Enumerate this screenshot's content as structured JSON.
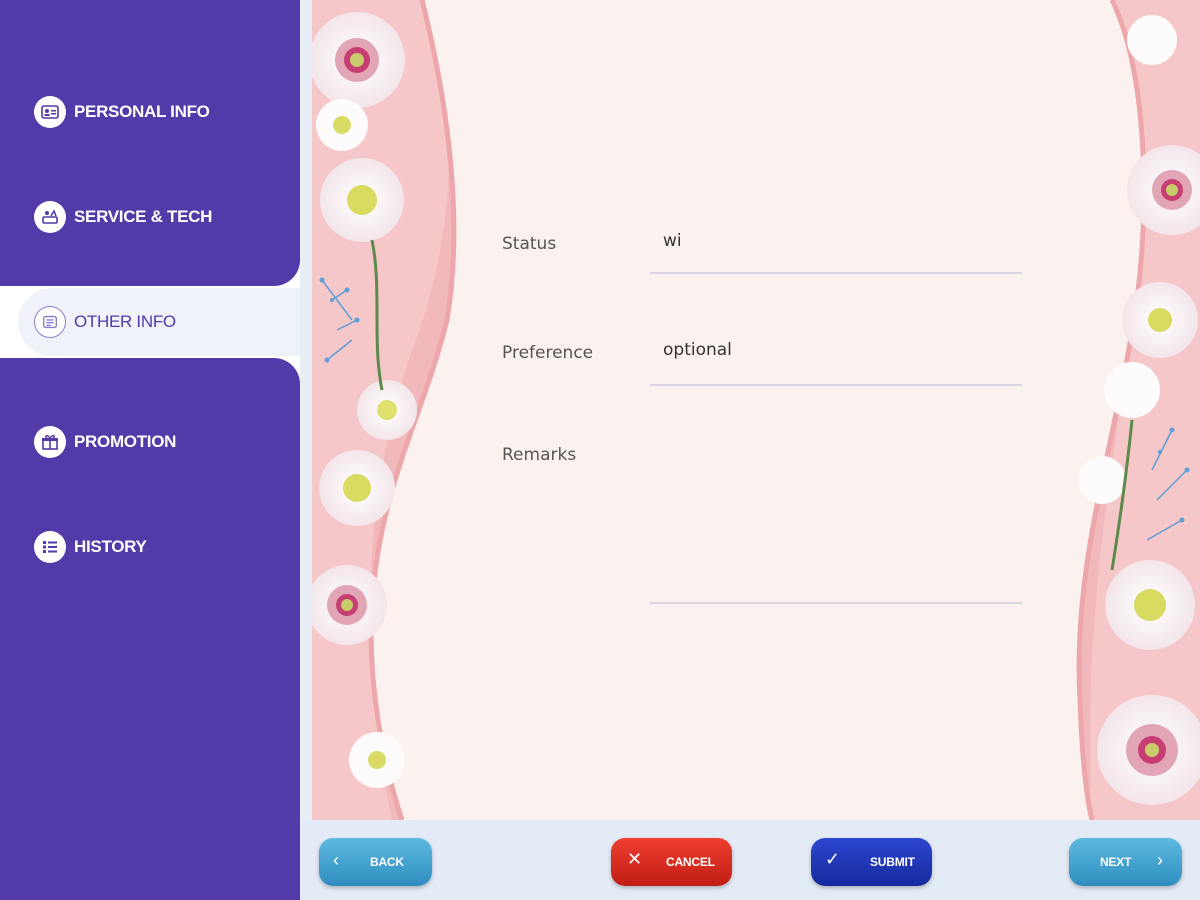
{
  "sidebar": {
    "items": [
      {
        "label": "PERSONAL INFO",
        "icon": "id-card-icon"
      },
      {
        "label": "SERVICE & TECH",
        "icon": "spa-icon"
      },
      {
        "label": "OTHER INFO",
        "icon": "info-card-icon",
        "active": true
      },
      {
        "label": "PROMOTION",
        "icon": "gift-icon"
      },
      {
        "label": "HISTORY",
        "icon": "list-icon"
      }
    ]
  },
  "form": {
    "status": {
      "label": "Status",
      "value": "wi"
    },
    "preference": {
      "label": "Preference",
      "value": "optional"
    },
    "remarks": {
      "label": "Remarks",
      "value": ""
    }
  },
  "footer": {
    "back_label": "BACK",
    "cancel_label": "CANCEL",
    "submit_label": "SUBMIT",
    "next_label": "NEXT"
  },
  "colors": {
    "sidebar": "#523aa8",
    "panel": "#fbf1ee",
    "back_next": "#3aa0d0",
    "cancel": "#d9281d",
    "submit": "#1e35b8"
  }
}
